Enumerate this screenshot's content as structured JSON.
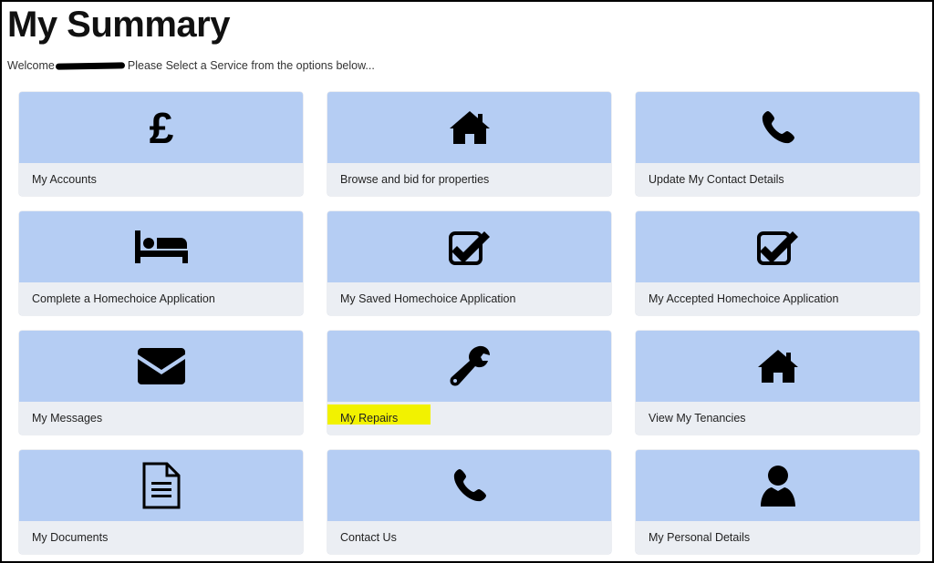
{
  "page": {
    "title": "My Summary",
    "welcome_prefix": "Welcome",
    "welcome_suffix": "Please Select a Service from the options below..."
  },
  "colors": {
    "tile_icon_bg": "#b5cdf3",
    "tile_label_bg": "#ebeef3",
    "highlight": "#f2f200"
  },
  "tiles": [
    {
      "label": "My Accounts",
      "icon": "pound-icon"
    },
    {
      "label": "Browse and bid for properties",
      "icon": "house-icon"
    },
    {
      "label": "Update My Contact Details",
      "icon": "phone-icon"
    },
    {
      "label": "Complete a Homechoice Application",
      "icon": "bed-icon"
    },
    {
      "label": "My Saved Homechoice Application",
      "icon": "checkbox-icon"
    },
    {
      "label": "My Accepted Homechoice Application",
      "icon": "checkbox-icon"
    },
    {
      "label": "My Messages",
      "icon": "envelope-icon"
    },
    {
      "label": "My Repairs",
      "icon": "wrench-icon"
    },
    {
      "label": "View My Tenancies",
      "icon": "house-icon"
    },
    {
      "label": "My Documents",
      "icon": "document-icon"
    },
    {
      "label": "Contact Us",
      "icon": "phone-icon"
    },
    {
      "label": "My Personal Details",
      "icon": "user-icon"
    }
  ]
}
